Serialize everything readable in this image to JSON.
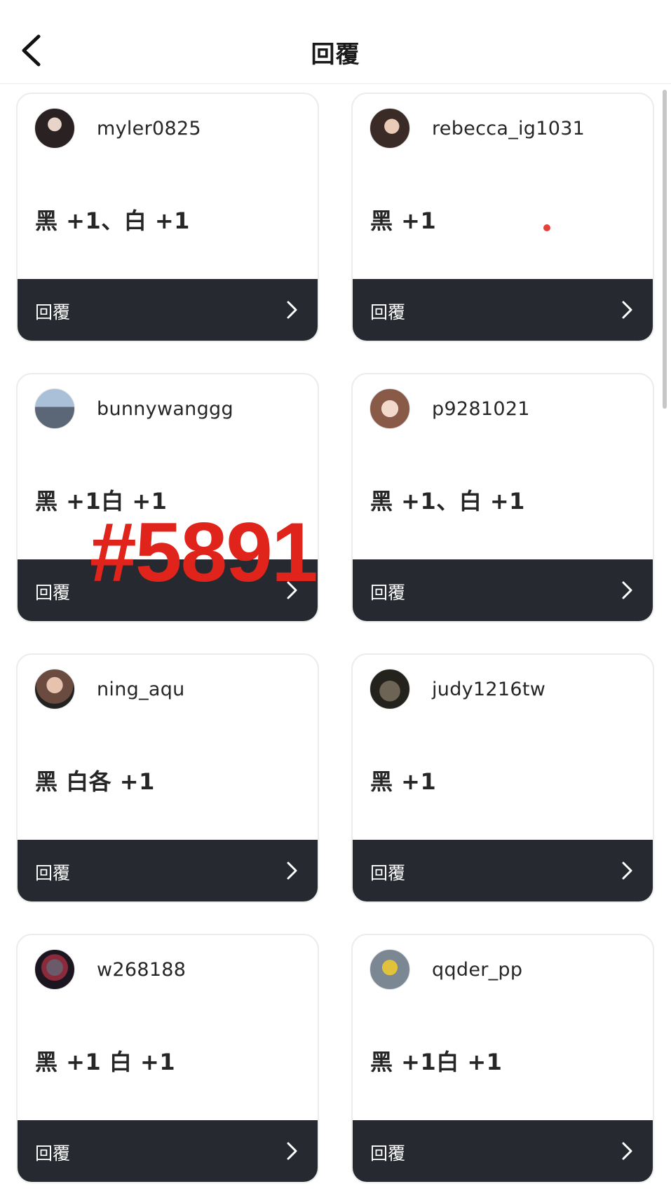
{
  "header": {
    "title": "回覆",
    "back_icon": "chevron-left-icon"
  },
  "cards": [
    {
      "username": "myler0825",
      "comment": "黑 +1、白 +1",
      "reply_label": "回覆",
      "avatar_color": "#3a2f2f"
    },
    {
      "username": "rebecca_ig1031",
      "comment": "黑 +1",
      "reply_label": "回覆",
      "avatar_color": "#4a3a35"
    },
    {
      "username": "bunnywanggg",
      "comment": "黑 +1白 +1",
      "reply_label": "回覆",
      "avatar_color": "#7a8fa8"
    },
    {
      "username": "p9281021",
      "comment": "黑 +1、白 +1",
      "reply_label": "回覆",
      "avatar_color": "#d9b8a8"
    },
    {
      "username": "ning_aqu",
      "comment": "黑 白各 +1",
      "reply_label": "回覆",
      "avatar_color": "#b08070"
    },
    {
      "username": "judy1216tw",
      "comment": "黑 +1",
      "reply_label": "回覆",
      "avatar_color": "#3a3a30"
    },
    {
      "username": "w268188",
      "comment": "黑 +1 白 +1",
      "reply_label": "回覆",
      "avatar_color": "#2a1f2a"
    },
    {
      "username": "qqder_pp",
      "comment": "黑 +1白 +1",
      "reply_label": "回覆",
      "avatar_color": "#8a8f95"
    }
  ],
  "overlay": {
    "watermark": "#5891",
    "watermark_color": "#e0241b"
  },
  "colors": {
    "reply_bar": "#262a30",
    "card_border": "#ececec"
  }
}
